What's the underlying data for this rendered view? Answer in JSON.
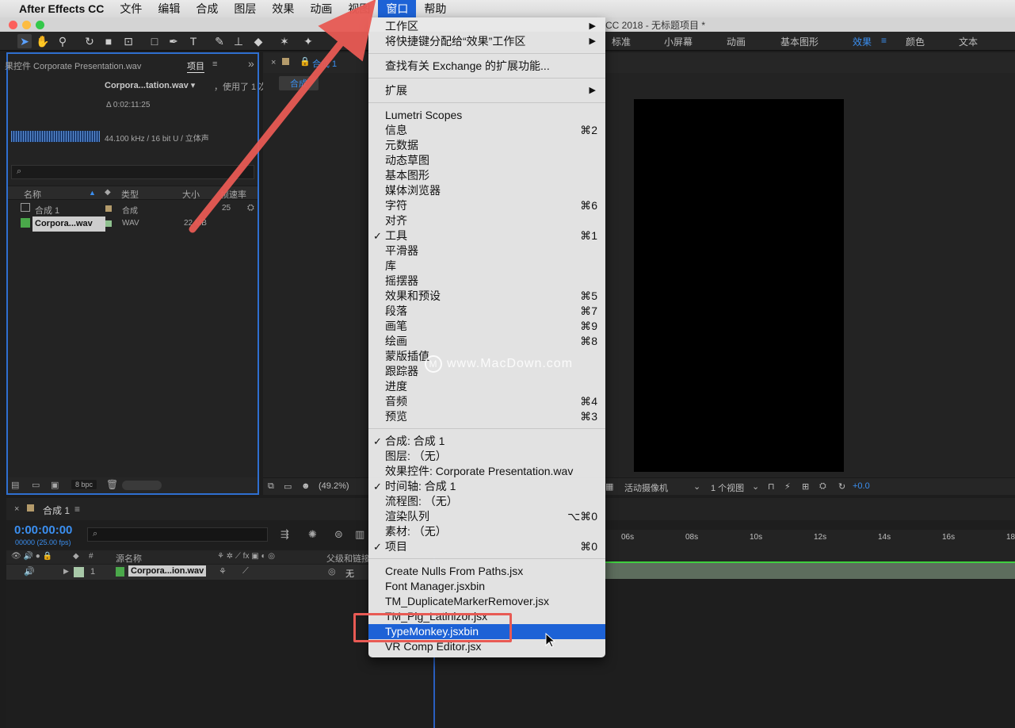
{
  "menubar": {
    "apple": "",
    "items": [
      "After Effects CC",
      "文件",
      "编辑",
      "合成",
      "图层",
      "效果",
      "动画",
      "视图",
      "窗口",
      "帮助"
    ],
    "active": "窗口"
  },
  "window": {
    "title": "CC 2018 - 无标题项目 *"
  },
  "workspace_tabs": [
    "标准",
    "小屏幕",
    "动画",
    "基本图形",
    "效果",
    "颜色",
    "文本"
  ],
  "workspace_active": "效果",
  "workspace_active_icon": "≡",
  "project": {
    "tab_effects": "果控件 Corporate Presentation.wav",
    "tab_project": "项目",
    "tab_menu_icon": "≡",
    "expand_icon": "»",
    "selected_name": "Corpora...tation.wav ▾",
    "used": "，使用了 1 次",
    "duration": "Δ 0:02:11:25",
    "audio_info": "44.100 kHz / 16 bit U / 立体声",
    "search_icon": "⌕",
    "columns": {
      "name": "名称",
      "type": "类型",
      "size": "大小",
      "framerate": "帧速率"
    },
    "rows": [
      {
        "name": "合成 1",
        "type": "合成",
        "size": "",
        "framerate": "25",
        "swatch": "#b49b6b"
      },
      {
        "name": "Corpora...wav",
        "type": "WAV",
        "size": "22 MB",
        "framerate": "",
        "swatch": "#8fc18f"
      }
    ],
    "bpc": "8 bpc"
  },
  "composition": {
    "tab": "合成 1",
    "tab_active": "合成 1",
    "subtab": "合成",
    "zoom": "(49.2%)",
    "camera": "活动摄像机",
    "views": "1 个视图",
    "exposure": "+0.0"
  },
  "timeline": {
    "tab": "合成 1",
    "tab_menu_icon": "≡",
    "timecode": "0:00:00:00",
    "fps": "00000 (25.00 fps)",
    "columns": {
      "source": "源名称",
      "hash": "#",
      "parent": "父级和链接"
    },
    "layer": {
      "index": "1",
      "name": "Corpora...ion.wav",
      "parent": "无"
    },
    "ruler_ticks": [
      "06s",
      "08s",
      "10s",
      "12s",
      "14s",
      "16s",
      "18"
    ]
  },
  "menu": {
    "groups": [
      [
        {
          "label": "工作区",
          "submenu": true
        },
        {
          "label": "将快捷键分配给“效果”工作区",
          "submenu": true
        }
      ],
      [
        {
          "label": "查找有关 Exchange 的扩展功能..."
        }
      ],
      [
        {
          "label": "扩展",
          "submenu": true
        }
      ],
      [
        {
          "label": "Lumetri Scopes"
        },
        {
          "label": "信息",
          "shortcut": "⌘2"
        },
        {
          "label": "元数据"
        },
        {
          "label": "动态草图"
        },
        {
          "label": "基本图形"
        },
        {
          "label": "媒体浏览器"
        },
        {
          "label": "字符",
          "shortcut": "⌘6"
        },
        {
          "label": "对齐"
        },
        {
          "label": "工具",
          "shortcut": "⌘1",
          "checked": true
        },
        {
          "label": "平滑器"
        },
        {
          "label": "库"
        },
        {
          "label": "摇摆器"
        },
        {
          "label": "效果和预设",
          "shortcut": "⌘5"
        },
        {
          "label": "段落",
          "shortcut": "⌘7"
        },
        {
          "label": "画笔",
          "shortcut": "⌘9"
        },
        {
          "label": "绘画",
          "shortcut": "⌘8"
        },
        {
          "label": "蒙版插值"
        },
        {
          "label": "跟踪器"
        },
        {
          "label": "进度"
        },
        {
          "label": "音频",
          "shortcut": "⌘4"
        },
        {
          "label": "预览",
          "shortcut": "⌘3"
        }
      ],
      [
        {
          "label": "合成: 合成 1",
          "checked": true
        },
        {
          "label": "图层: （无）"
        },
        {
          "label": "效果控件: Corporate Presentation.wav"
        },
        {
          "label": "时间轴: 合成 1",
          "checked": true
        },
        {
          "label": "流程图: （无）"
        },
        {
          "label": "渲染队列",
          "shortcut": "⌥⌘0"
        },
        {
          "label": "素材: （无）"
        },
        {
          "label": "项目",
          "shortcut": "⌘0",
          "checked": true
        }
      ],
      [
        {
          "label": "Create Nulls From Paths.jsx"
        },
        {
          "label": "Font Manager.jsxbin"
        },
        {
          "label": "TM_DuplicateMarkerRemover.jsx"
        },
        {
          "label": "TM_Pig_Latinizor.jsx"
        },
        {
          "label": "TypeMonkey.jsxbin",
          "highlighted": true
        },
        {
          "label": "VR Comp Editor.jsx"
        }
      ]
    ]
  },
  "watermark": {
    "logo": "M",
    "text": "www.MacDown.com"
  },
  "colors": {
    "accent": "#1d62d6",
    "annotation": "#e85a54",
    "panel_focus": "#2f6fd0",
    "timecode": "#3b8ff0"
  }
}
